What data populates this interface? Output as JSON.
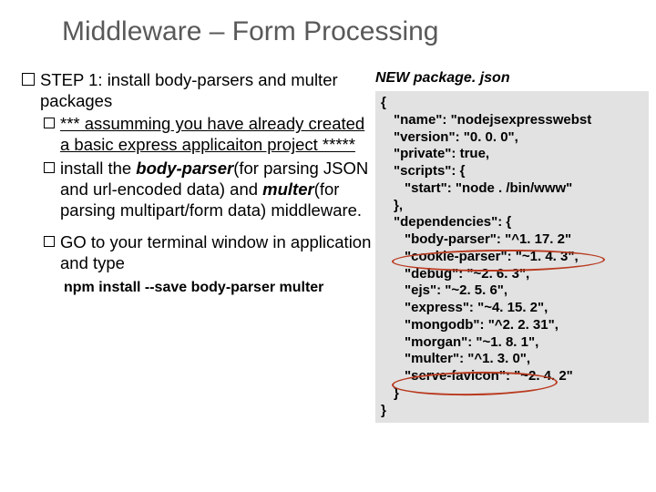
{
  "title": "Middleware – Form Processing",
  "left": {
    "step1": "STEP 1: install body-parsers and multer packages",
    "sub1_underlined": "*** assumming you have already created a basic express applicaiton project *****",
    "sub2_prefix": " install the ",
    "sub2_bp": "body-parser",
    "sub2_mid": "(for parsing JSON and url-encoded data) and ",
    "sub2_multer": "multer",
    "sub2_tail": "(for parsing multipart/form data) middleware.",
    "sub3": "GO to your terminal window in application and type",
    "npm": "npm install --save body-parser multer"
  },
  "right": {
    "newlabel": "NEW package. json",
    "l0": "{",
    "l1": "\"name\": \"nodejsexpresswebst",
    "l2": "\"version\": \"0. 0. 0\",",
    "l3": "\"private\": true,",
    "l4": "\"scripts\": {",
    "l5": "\"start\": \"node . /bin/www\"",
    "l6": "},",
    "l7": "\"dependencies\": {",
    "l8": "\"body-parser\": \"^1. 17. 2\"",
    "l9": "\"cookie-parser\": \"~1. 4. 3\",",
    "l10": "\"debug\": \"~2. 6. 3\",",
    "l11": "\"ejs\": \"~2. 5. 6\",",
    "l12": "\"express\": \"~4. 15. 2\",",
    "l13": "\"mongodb\": \"^2. 2. 31\",",
    "l14": "\"morgan\": \"~1. 8. 1\",",
    "l15": "\"multer\": \"^1. 3. 0\",",
    "l16": "\"serve-favicon\": \"~2. 4. 2\"",
    "l17": "}",
    "l18": "}"
  }
}
